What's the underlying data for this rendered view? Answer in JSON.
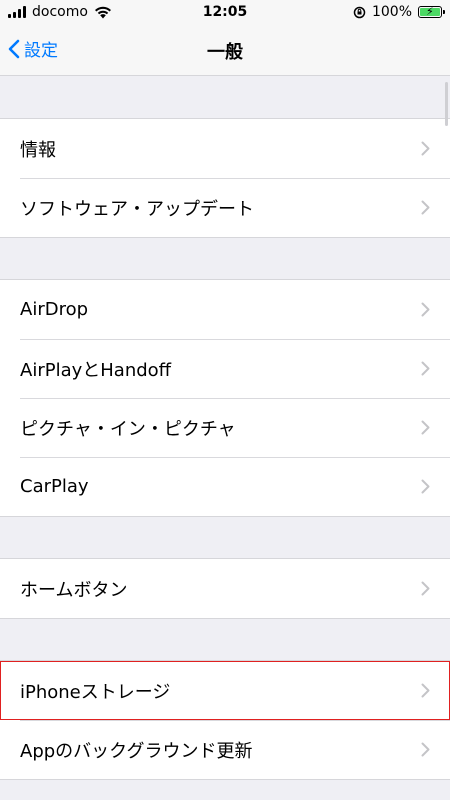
{
  "status_bar": {
    "carrier": "docomo",
    "time": "12:05",
    "battery_percent": "100%",
    "battery_level": 1.0,
    "icons": [
      "signal-icon",
      "wifi-icon",
      "rotation-lock-icon",
      "battery-icon"
    ]
  },
  "nav": {
    "back_label": "設定",
    "title": "一般"
  },
  "groups": [
    {
      "items": [
        {
          "label": "情報"
        },
        {
          "label": "ソフトウェア・アップデート"
        }
      ]
    },
    {
      "items": [
        {
          "label": "AirDrop"
        },
        {
          "label": "AirPlayとHandoff"
        },
        {
          "label": "ピクチャ・イン・ピクチャ"
        },
        {
          "label": "CarPlay"
        }
      ]
    },
    {
      "items": [
        {
          "label": "ホームボタン"
        }
      ]
    },
    {
      "items": [
        {
          "label": "iPhoneストレージ",
          "highlighted": true
        },
        {
          "label": "Appのバックグラウンド更新"
        }
      ]
    }
  ],
  "colors": {
    "accent": "#007aff",
    "background": "#efeff4",
    "highlight_border": "#e02020",
    "battery_fill": "#4cd964"
  }
}
